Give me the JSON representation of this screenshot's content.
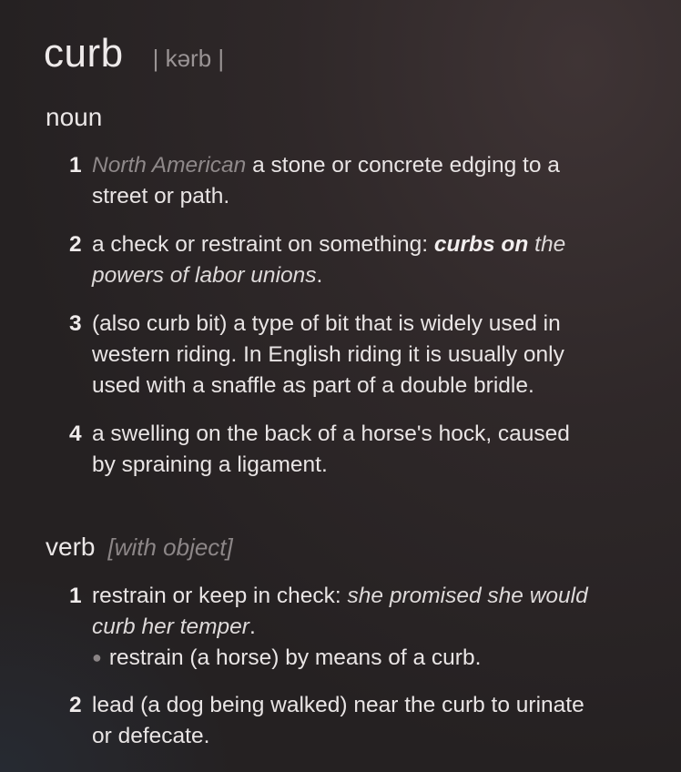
{
  "entry": {
    "headword": "curb",
    "pronunciation": "| kərb |"
  },
  "noun": {
    "label": "noun",
    "senses": [
      {
        "number": "1",
        "region": "North American",
        "line1": "a stone or concrete edging to a",
        "line2": "street or path."
      },
      {
        "number": "2",
        "text": "a check or restraint on something:",
        "example_bold": "curbs on",
        "example_line1": "the",
        "example_line2": "powers of labor unions",
        "end": "."
      },
      {
        "number": "3",
        "line1": "(also curb bit) a type of bit that is widely used in",
        "line2": "western riding. In English riding it is usually only",
        "line3": "used with a snaffle as part of a double bridle."
      },
      {
        "number": "4",
        "line1": "a swelling on the back of a horse's hock, caused",
        "line2": "by spraining a ligament."
      }
    ]
  },
  "verb": {
    "label": "verb",
    "note": "[with object]",
    "senses": [
      {
        "number": "1",
        "text": "restrain or keep in check:",
        "example_line1": "she promised she would",
        "example_line2": "curb her temper",
        "end": ".",
        "subsense": "restrain (a horse) by means of a curb."
      },
      {
        "number": "2",
        "line1": "lead (a dog being walked) near the curb to urinate",
        "line2": "or defecate."
      }
    ]
  }
}
